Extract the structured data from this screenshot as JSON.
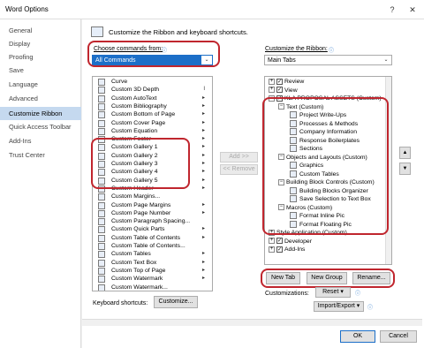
{
  "window": {
    "title": "Word Options",
    "help": "?",
    "close": "✕"
  },
  "nav": [
    "General",
    "Display",
    "Proofing",
    "Save",
    "Language",
    "Advanced",
    "Customize Ribbon",
    "Quick Access Toolbar",
    "Add-Ins",
    "Trust Center"
  ],
  "header": {
    "text": "Customize the Ribbon and keyboard shortcuts."
  },
  "left": {
    "label": "Choose commands from:",
    "value": "All Commands",
    "items": [
      {
        "t": "Curve",
        "a": ""
      },
      {
        "t": "Custom 3D Depth",
        "a": "I"
      },
      {
        "t": "Custom AutoText",
        "a": "▸"
      },
      {
        "t": "Custom Bibliography",
        "a": "▸"
      },
      {
        "t": "Custom Bottom of Page",
        "a": "▸"
      },
      {
        "t": "Custom Cover Page",
        "a": "▸"
      },
      {
        "t": "Custom Equation",
        "a": "▸"
      },
      {
        "t": "Custom Footer",
        "a": "▸"
      },
      {
        "t": "Custom Gallery 1",
        "a": "▸"
      },
      {
        "t": "Custom Gallery 2",
        "a": "▸"
      },
      {
        "t": "Custom Gallery 3",
        "a": "▸"
      },
      {
        "t": "Custom Gallery 4",
        "a": "▸"
      },
      {
        "t": "Custom Gallery 5",
        "a": "▸"
      },
      {
        "t": "Custom Header",
        "a": "▸"
      },
      {
        "t": "Custom Margins...",
        "a": ""
      },
      {
        "t": "Custom Page Margins",
        "a": "▸"
      },
      {
        "t": "Custom Page Number",
        "a": "▸"
      },
      {
        "t": "Custom Paragraph Spacing...",
        "a": ""
      },
      {
        "t": "Custom Quick Parts",
        "a": "▸"
      },
      {
        "t": "Custom Table of Contents",
        "a": "▸"
      },
      {
        "t": "Custom Table of Contents...",
        "a": ""
      },
      {
        "t": "Custom Tables",
        "a": "▸"
      },
      {
        "t": "Custom Text Box",
        "a": "▸"
      },
      {
        "t": "Custom Top of Page",
        "a": "▸"
      },
      {
        "t": "Custom Watermark",
        "a": "▸"
      },
      {
        "t": "Custom Watermark...",
        "a": ""
      }
    ],
    "keyboard_label": "Keyboard shortcuts:",
    "customize_btn": "Customize..."
  },
  "middle": {
    "add": "Add >>",
    "remove": "<< Remove"
  },
  "right": {
    "label": "Customize the Ribbon:",
    "value": "Main Tabs",
    "tree": [
      {
        "lvl": 1,
        "pm": "+",
        "cb": "✓",
        "t": "Review"
      },
      {
        "lvl": 1,
        "pm": "+",
        "cb": "✓",
        "t": "View"
      },
      {
        "lvl": 1,
        "pm": "−",
        "cb": "✓",
        "t": "KLA PROPOSAL ASSETS (Custom)"
      },
      {
        "lvl": 2,
        "pm": "−",
        "t": "Text (Custom)"
      },
      {
        "lvl": 3,
        "t": "Project Write-Ups"
      },
      {
        "lvl": 3,
        "t": "Processes & Methods"
      },
      {
        "lvl": 3,
        "t": "Company Information"
      },
      {
        "lvl": 3,
        "t": "Response Boilerplates"
      },
      {
        "lvl": 3,
        "t": "Sections"
      },
      {
        "lvl": 2,
        "pm": "−",
        "t": "Objects and Layouts (Custom)"
      },
      {
        "lvl": 3,
        "t": "Graphics"
      },
      {
        "lvl": 3,
        "t": "Custom Tables"
      },
      {
        "lvl": 2,
        "pm": "−",
        "t": "Building Block Controls (Custom)"
      },
      {
        "lvl": 3,
        "t": "Building Blocks Organizer"
      },
      {
        "lvl": 3,
        "t": "Save Selection to Text Box"
      },
      {
        "lvl": 2,
        "pm": "−",
        "t": "Macros (Custom)"
      },
      {
        "lvl": 3,
        "t": "Format Inline Pic"
      },
      {
        "lvl": 3,
        "t": "Format Floating Pic"
      },
      {
        "lvl": 1,
        "pm": "+",
        "t": "Style Application (Custom)"
      },
      {
        "lvl": 1,
        "pm": "+",
        "cb": "✓",
        "t": "Developer"
      },
      {
        "lvl": 1,
        "pm": "+",
        "cb": "✓",
        "t": "Add-Ins"
      }
    ],
    "new_tab": "New Tab",
    "new_group": "New Group",
    "rename": "Rename...",
    "customizations_label": "Customizations:",
    "reset": "Reset",
    "import_export": "Import/Export"
  },
  "footer": {
    "ok": "OK",
    "cancel": "Cancel"
  }
}
